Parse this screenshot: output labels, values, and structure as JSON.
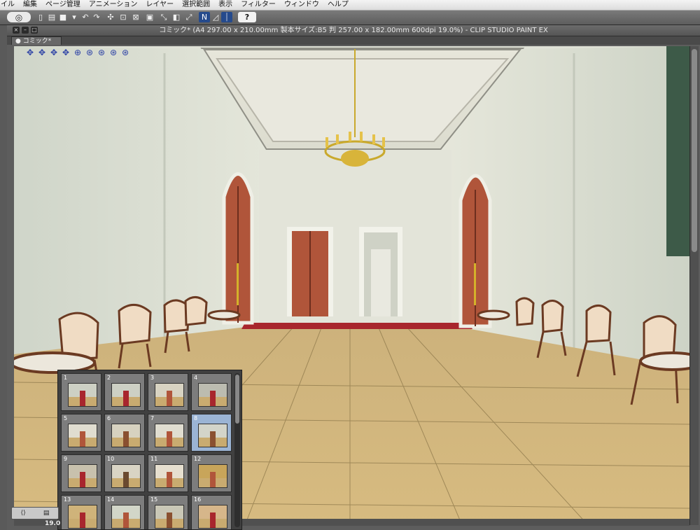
{
  "menubar": {
    "items": [
      "イル",
      "編集",
      "ページ管理",
      "アニメーション",
      "レイヤー",
      "選択範囲",
      "表示",
      "フィルター",
      "ウィンドウ",
      "ヘルプ"
    ]
  },
  "toolbar": {
    "logo_icon": "clip-studio-logo-icon",
    "help_label": "?"
  },
  "window": {
    "title": "コミック* (A4 297.00 x 210.00mm 製本サイズ:B5 判 257.00 x 182.00mm 600dpi 19.0%)  - CLIP STUDIO PAINT EX"
  },
  "document_tab": {
    "label": "コミック*"
  },
  "status": {
    "zoom": "19.0"
  },
  "page_manager": {
    "pages": [
      {
        "number": "1"
      },
      {
        "number": "2"
      },
      {
        "number": "3"
      },
      {
        "number": "4"
      },
      {
        "number": "5"
      },
      {
        "number": "6"
      },
      {
        "number": "7"
      },
      {
        "number": "8"
      },
      {
        "number": "9"
      },
      {
        "number": "10"
      },
      {
        "number": "11"
      },
      {
        "number": "12"
      },
      {
        "number": "13"
      },
      {
        "number": "14"
      },
      {
        "number": "15"
      },
      {
        "number": "16"
      }
    ]
  },
  "colors": {
    "wall": "#d9ddd0",
    "floor": "#d3b679",
    "door": "#b0553a",
    "carpet": "#a8262d",
    "accent": "#254a8c"
  }
}
